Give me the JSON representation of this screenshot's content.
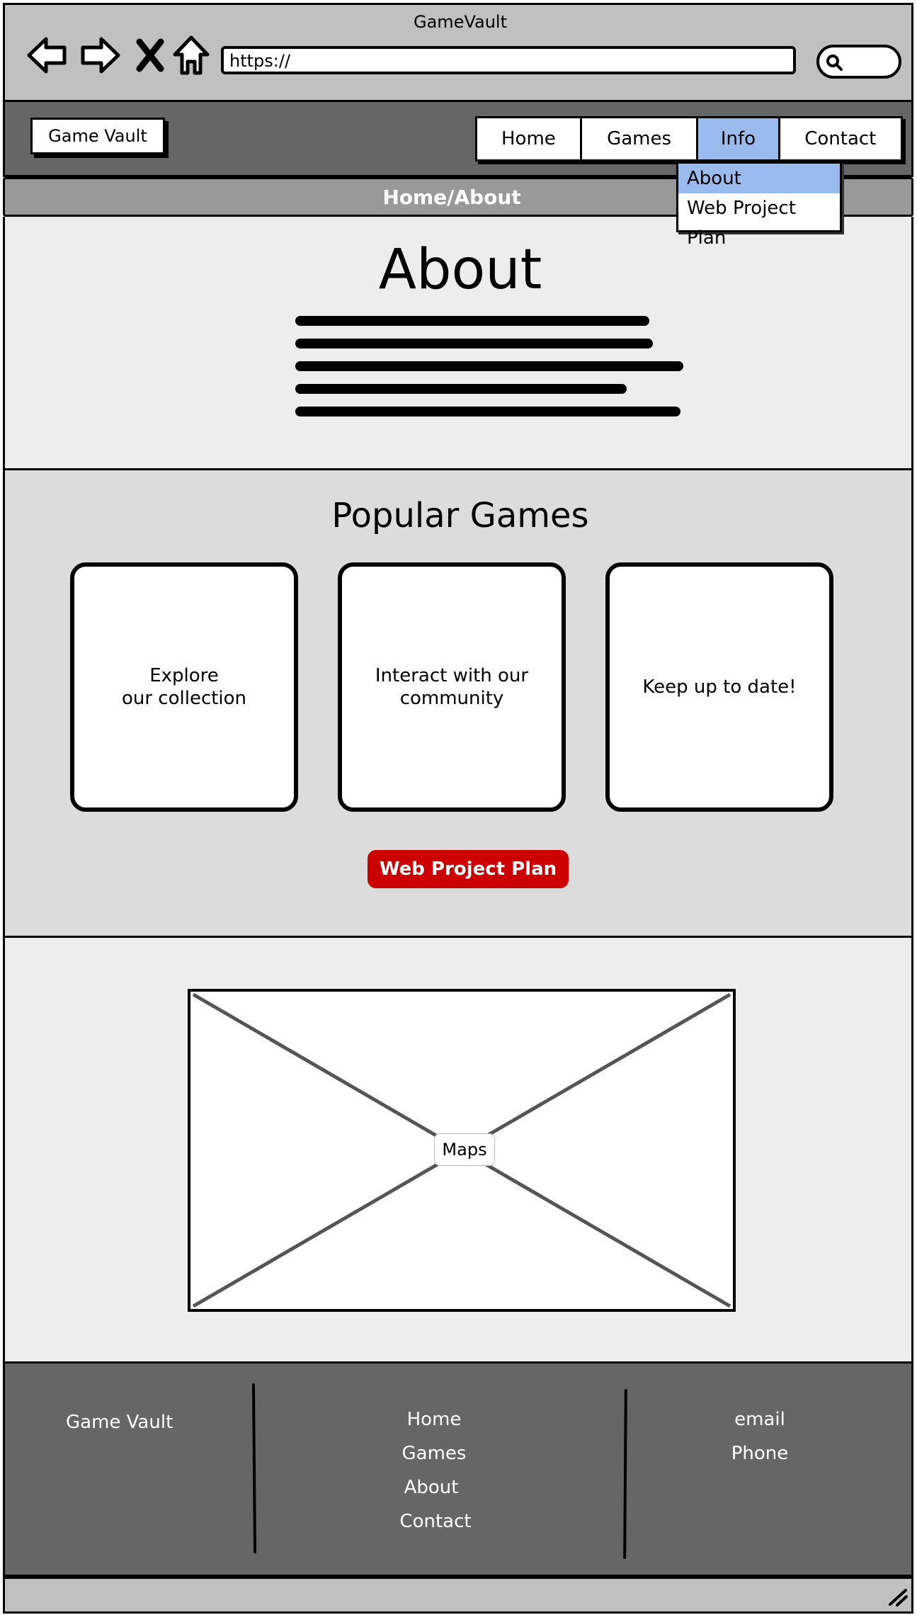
{
  "browser": {
    "window_title": "GameVault",
    "url": "https://",
    "icons": [
      "back-arrow-icon",
      "forward-arrow-icon",
      "stop-icon",
      "home-icon",
      "search-icon"
    ]
  },
  "site_nav": {
    "logo": "Game Vault",
    "tabs": [
      {
        "label": "Home"
      },
      {
        "label": "Games"
      },
      {
        "label": "Info",
        "active": true
      },
      {
        "label": "Contact"
      }
    ],
    "dropdown": [
      {
        "label": "About",
        "selected": true
      },
      {
        "label": "Web Project Plan"
      }
    ]
  },
  "breadcrumb": "Home/About",
  "about": {
    "title": "About"
  },
  "popular": {
    "title": "Popular Games",
    "cards": [
      {
        "line1": "Explore",
        "line2": "our collection"
      },
      {
        "line1": "Interact with our",
        "line2": "community"
      },
      {
        "line1": "Keep up to date!",
        "line2": ""
      }
    ],
    "button": "Web Project Plan"
  },
  "map": {
    "label": "Maps"
  },
  "footer": {
    "brand": "Game Vault",
    "links": [
      "Home",
      "Games",
      "About",
      "Contact"
    ],
    "contact": [
      "email",
      "Phone"
    ]
  },
  "colors": {
    "chrome": "#c0c0c0",
    "nav_bar": "#666666",
    "active_tab": "#99bbee",
    "breadcrumb_bar": "#999999",
    "section_light": "#ededed",
    "section_grey": "#dcdcdc",
    "cta_red": "#cc0000"
  }
}
